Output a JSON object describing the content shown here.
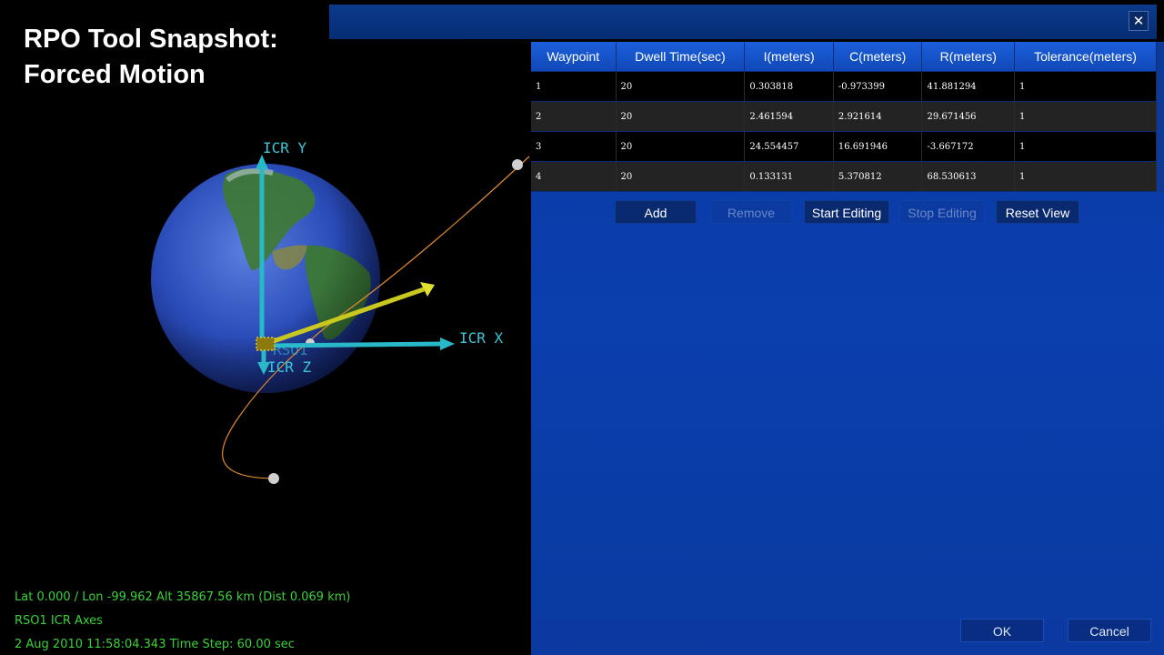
{
  "snapshot": {
    "title_line1": "RPO Tool Snapshot:",
    "title_line2": "Forced Motion"
  },
  "viewport": {
    "axis_labels": {
      "y": "ICR Y",
      "x": "ICR X",
      "z": "ICR Z",
      "object": "RSO1"
    },
    "status": {
      "position": "Lat  0.000 / Lon -99.962  Alt 35867.56 km (Dist 0.069 km)",
      "frame": "RSO1 ICR Axes",
      "time": "2 Aug 2010 11:58:04.343    Time Step: 60.00 sec"
    },
    "colors": {
      "axis": "#38c8d8",
      "vector": "#c8c820",
      "trajectory": "#e08a30",
      "status_text": "#3ad23a"
    }
  },
  "dialog": {
    "close_glyph": "✕",
    "table": {
      "columns": [
        "Waypoint",
        "Dwell Time(sec)",
        "I(meters)",
        "C(meters)",
        "R(meters)",
        "Tolerance(meters)"
      ],
      "rows": [
        [
          "1",
          "20",
          "0.303818",
          "-0.973399",
          "41.881294",
          "1"
        ],
        [
          "2",
          "20",
          "2.461594",
          "2.921614",
          "29.671456",
          "1"
        ],
        [
          "3",
          "20",
          "24.554457",
          "16.691946",
          "-3.667172",
          "1"
        ],
        [
          "4",
          "20",
          "0.133131",
          "5.370812",
          "68.530613",
          "1"
        ]
      ]
    },
    "toolbar": {
      "add": "Add",
      "remove": "Remove",
      "start_editing": "Start Editing",
      "stop_editing": "Stop Editing",
      "reset_view": "Reset View"
    },
    "footer": {
      "ok": "OK",
      "cancel": "Cancel"
    },
    "colors": {
      "body": "#0b3fae",
      "header": "#1a5fdc"
    }
  }
}
